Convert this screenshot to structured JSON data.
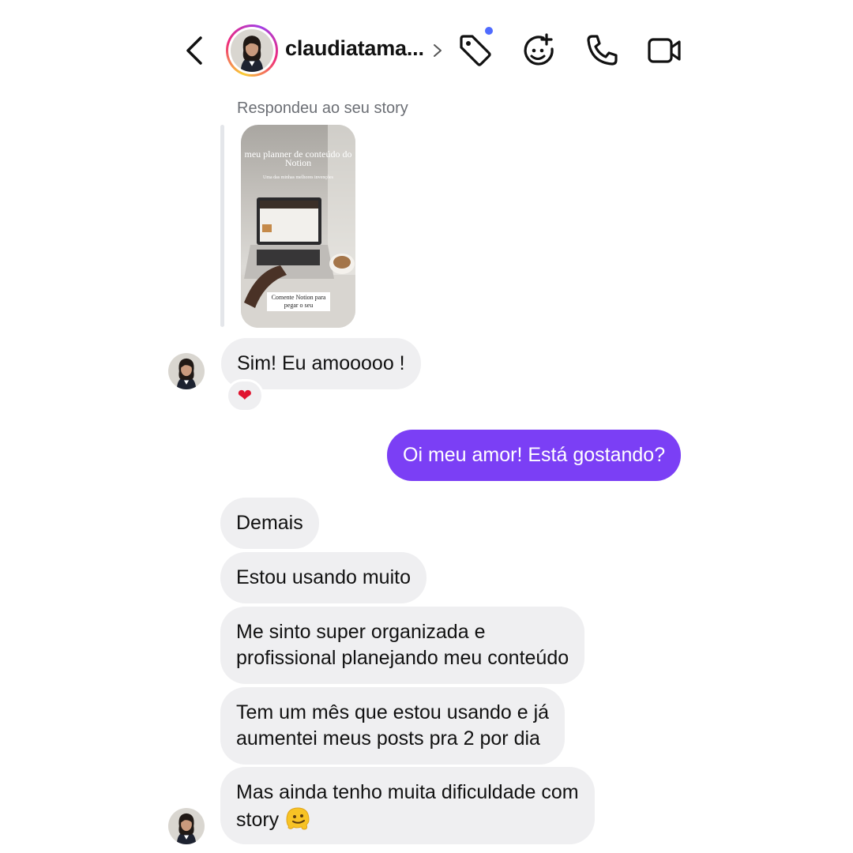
{
  "header": {
    "username": "claudiatama...",
    "accent_dot_color": "#4f6bff"
  },
  "story_reply": {
    "label": "Respondeu ao seu story",
    "card_title": "meu planner de conteúdo do Notion",
    "card_subtitle": "Uma das minhas melhores invenções",
    "card_cta": "Comente Notion para pegar o seu"
  },
  "messages": [
    {
      "id": "m1",
      "direction": "incoming",
      "text": "Sim! Eu amooooo !",
      "reaction": "heart"
    },
    {
      "id": "m2",
      "direction": "outgoing",
      "text": "Oi meu amor! Está gostando?"
    },
    {
      "id": "m3",
      "direction": "incoming",
      "text": "Demais"
    },
    {
      "id": "m4",
      "direction": "incoming",
      "text": "Estou usando muito"
    },
    {
      "id": "m5",
      "direction": "incoming",
      "lines": [
        "Me sinto super organizada e",
        "profissional planejando meu conteúdo"
      ]
    },
    {
      "id": "m6",
      "direction": "incoming",
      "lines": [
        "Tem um mês que estou usando e já",
        "aumentei meus posts pra 2 por dia"
      ]
    },
    {
      "id": "m7",
      "direction": "incoming",
      "lines": [
        "Mas ainda tenho muita dificuldade com",
        "story"
      ],
      "trailing_emoji": "melting-face"
    }
  ],
  "colors": {
    "outgoing_bubble": "#7b3ff5",
    "incoming_bubble": "#efeff1"
  }
}
